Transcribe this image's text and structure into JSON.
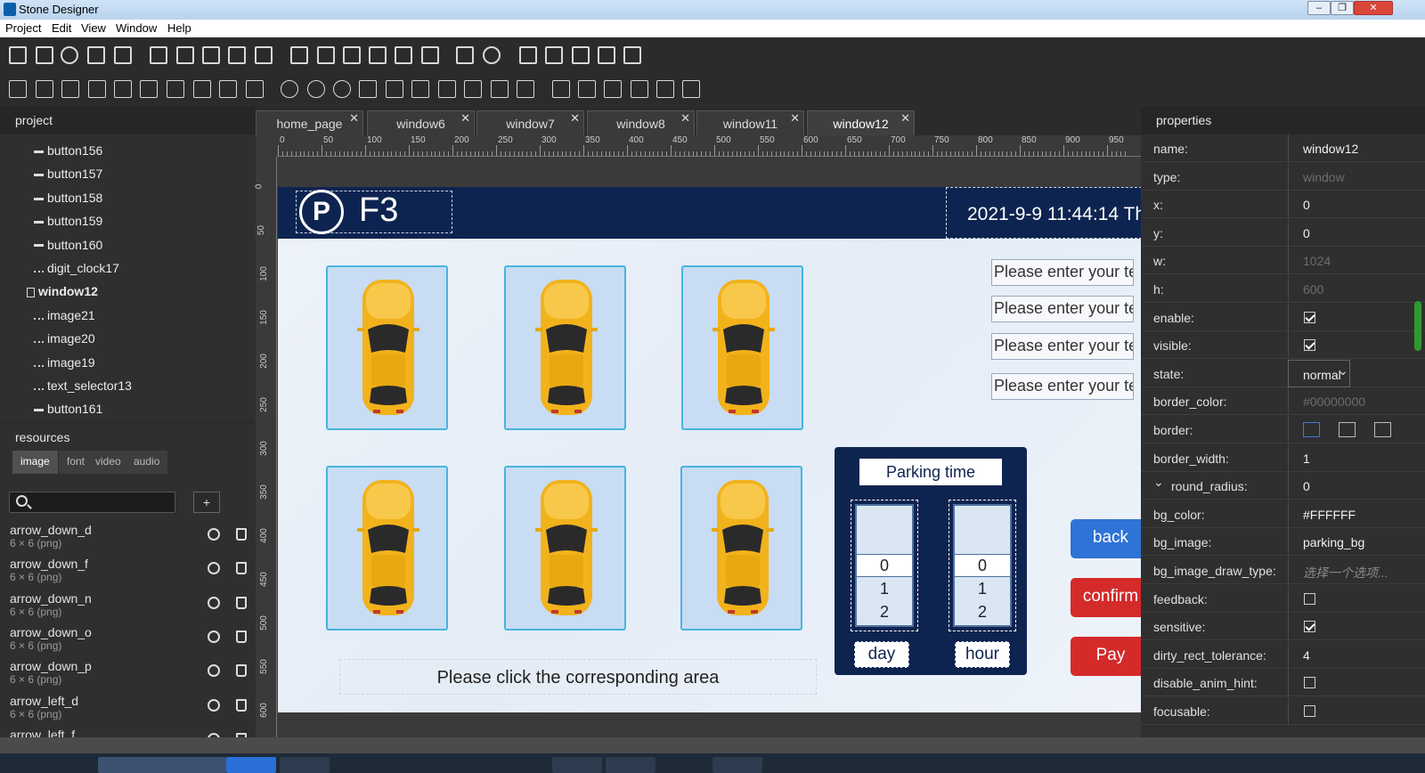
{
  "window": {
    "title": "Stone Designer",
    "min": "–",
    "max": "❐",
    "close": "✕"
  },
  "menu": [
    "Project",
    "Edit",
    "View",
    "Window",
    "Help"
  ],
  "project": {
    "header": "project",
    "items": [
      {
        "label": "button156",
        "icon": "button-icon"
      },
      {
        "label": "button157",
        "icon": "button-icon"
      },
      {
        "label": "button158",
        "icon": "button-icon"
      },
      {
        "label": "button159",
        "icon": "button-icon"
      },
      {
        "label": "button160",
        "icon": "button-icon"
      },
      {
        "label": "digit_clock17",
        "icon": "digit-clock-icon"
      },
      {
        "label": "window12",
        "icon": "window-icon"
      },
      {
        "label": "image21",
        "icon": "image-icon"
      },
      {
        "label": "image20",
        "icon": "image-icon"
      },
      {
        "label": "image19",
        "icon": "image-icon"
      },
      {
        "label": "text_selector13",
        "icon": "text-selector-icon"
      },
      {
        "label": "button161",
        "icon": "button-icon"
      }
    ]
  },
  "resources": {
    "header": "resources",
    "tabs": [
      "image",
      "font",
      "video",
      "audio"
    ],
    "add": "+",
    "items": [
      {
        "name": "arrow_down_d",
        "info": "6 × 6 (png)"
      },
      {
        "name": "arrow_down_f",
        "info": "6 × 6 (png)"
      },
      {
        "name": "arrow_down_n",
        "info": "6 × 6 (png)"
      },
      {
        "name": "arrow_down_o",
        "info": "6 × 6 (png)"
      },
      {
        "name": "arrow_down_p",
        "info": "6 × 6 (png)"
      },
      {
        "name": "arrow_left_d",
        "info": "6 × 6 (png)"
      },
      {
        "name": "arrow_left_f",
        "info": ""
      }
    ]
  },
  "editor": {
    "tabs": [
      "home_page",
      "window6",
      "window7",
      "window8",
      "window11",
      "window12"
    ],
    "active_tab": "window12",
    "ruler_h": [
      "0",
      "50",
      "100",
      "150",
      "200",
      "250",
      "300",
      "350",
      "400",
      "450",
      "500",
      "550",
      "600",
      "650",
      "700",
      "750",
      "800",
      "850",
      "900",
      "950"
    ],
    "ruler_v": [
      "0",
      "50",
      "100",
      "150",
      "200",
      "250",
      "300",
      "350",
      "400",
      "450",
      "500",
      "550",
      "600"
    ]
  },
  "canvas": {
    "logo": "P",
    "floor": "F3",
    "clock": "2021-9-9 11:44:14 Th",
    "inputs": [
      "Please enter your te:",
      "Please enter your te:",
      "Please enter your te:",
      "Please enter your te:"
    ],
    "parking_time": {
      "title": "Parking time",
      "day": {
        "values": [
          "0",
          "1",
          "2"
        ],
        "label": "day"
      },
      "hour": {
        "values": [
          "0",
          "1",
          "2"
        ],
        "label": "hour"
      }
    },
    "buttons": {
      "back": "back",
      "confirm": "confirm",
      "pay": "Pay"
    },
    "hint": "Please click the corresponding area",
    "colors": {
      "banner": "#0e2450",
      "back": "#2f73d6",
      "confirm": "#d42a2a",
      "pay": "#d42a2a",
      "slot_border": "#48b4e0",
      "car": "#f2b21b"
    }
  },
  "properties": {
    "header": "properties",
    "rows": [
      {
        "key": "name:",
        "type": "text",
        "value": "window12"
      },
      {
        "key": "type:",
        "type": "dim",
        "value": "window"
      },
      {
        "key": "x:",
        "type": "text",
        "value": "0"
      },
      {
        "key": "y:",
        "type": "text",
        "value": "0"
      },
      {
        "key": "w:",
        "type": "dim",
        "value": "1024"
      },
      {
        "key": "h:",
        "type": "dim",
        "value": "600"
      },
      {
        "key": "enable:",
        "type": "check",
        "checked": true
      },
      {
        "key": "visible:",
        "type": "check",
        "checked": true
      },
      {
        "key": "state:",
        "type": "select",
        "value": "normal"
      },
      {
        "key": "border_color:",
        "type": "dim",
        "value": "#00000000"
      },
      {
        "key": "border:",
        "type": "border"
      },
      {
        "key": "border_width:",
        "type": "text",
        "value": "1"
      },
      {
        "key": "round_radius:",
        "type": "text",
        "value": "0"
      },
      {
        "key": "bg_color:",
        "type": "text",
        "value": "#FFFFFF"
      },
      {
        "key": "bg_image:",
        "type": "text",
        "value": "parking_bg"
      },
      {
        "key": "bg_image_draw_type:",
        "type": "ph",
        "value": "选择一个选项..."
      },
      {
        "key": "feedback:",
        "type": "check",
        "checked": false
      },
      {
        "key": "sensitive:",
        "type": "check",
        "checked": true
      },
      {
        "key": "dirty_rect_tolerance:",
        "type": "text",
        "value": "4"
      },
      {
        "key": "disable_anim_hint:",
        "type": "check",
        "checked": false
      },
      {
        "key": "focusable:",
        "type": "check",
        "checked": false
      }
    ]
  }
}
